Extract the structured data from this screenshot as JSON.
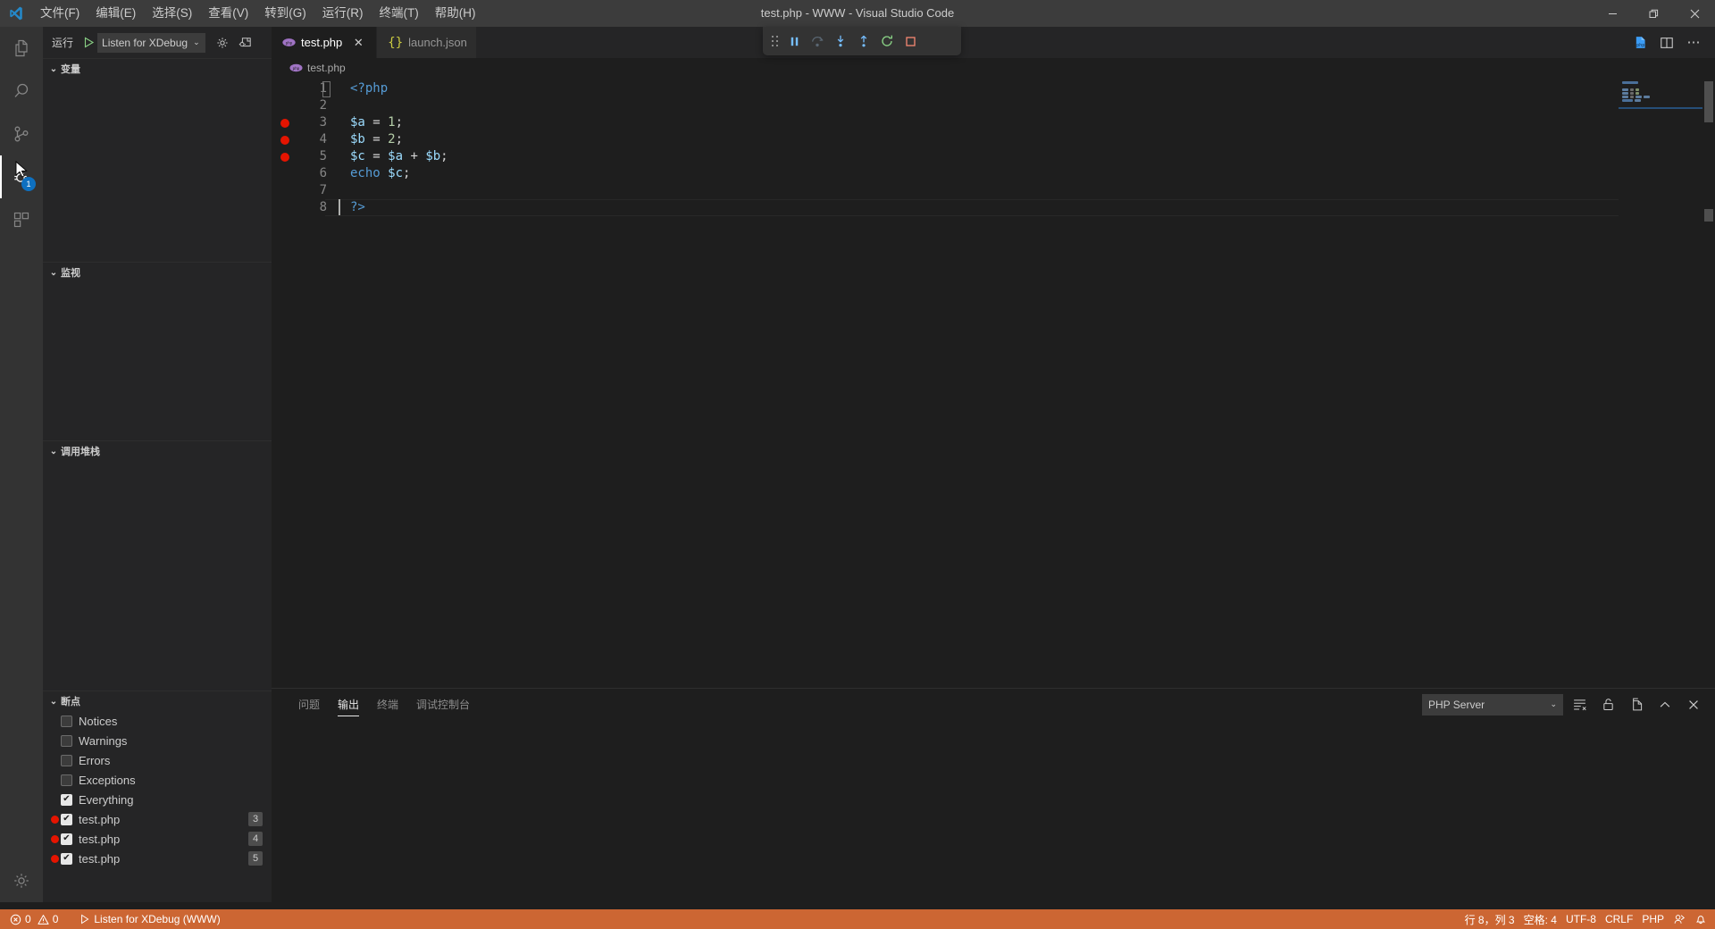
{
  "window": {
    "title": "test.php - WWW - Visual Studio Code",
    "controls": {
      "minimize": "minimize-icon",
      "maximize": "restore-icon",
      "close": "close-icon"
    }
  },
  "menubar": {
    "items": [
      {
        "label": "文件(F)",
        "name": "menu-file"
      },
      {
        "label": "编辑(E)",
        "name": "menu-edit"
      },
      {
        "label": "选择(S)",
        "name": "menu-selection"
      },
      {
        "label": "查看(V)",
        "name": "menu-view"
      },
      {
        "label": "转到(G)",
        "name": "menu-go"
      },
      {
        "label": "运行(R)",
        "name": "menu-run"
      },
      {
        "label": "终端(T)",
        "name": "menu-terminal"
      },
      {
        "label": "帮助(H)",
        "name": "menu-help"
      }
    ]
  },
  "activitybar": {
    "items": [
      {
        "icon": "explorer-icon",
        "name": "activity-explorer",
        "active": false,
        "badge": ""
      },
      {
        "icon": "search-icon",
        "name": "activity-search",
        "active": false,
        "badge": ""
      },
      {
        "icon": "source-control-icon",
        "name": "activity-source-control",
        "active": false,
        "badge": ""
      },
      {
        "icon": "run-and-debug-icon",
        "name": "activity-run-debug",
        "active": true,
        "badge": "1"
      },
      {
        "icon": "extensions-icon",
        "name": "activity-extensions",
        "active": false,
        "badge": ""
      }
    ],
    "manage": {
      "icon": "gear-icon",
      "name": "activity-manage"
    }
  },
  "debug_sidebar": {
    "run_label": "运行",
    "configuration": "Listen for XDebug",
    "config_caret": "⌄",
    "start_icon": "play-icon",
    "gear_icon": "gear-icon",
    "open_debug_icon": "open-debug-console-icon",
    "sections": [
      {
        "title": "变量",
        "name": "section-variables",
        "chevron": "⌄"
      },
      {
        "title": "监视",
        "name": "section-watch",
        "chevron": "⌄"
      },
      {
        "title": "调用堆栈",
        "name": "section-call-stack",
        "chevron": "⌄"
      },
      {
        "title": "断点",
        "name": "section-breakpoints",
        "chevron": "⌄"
      }
    ],
    "breakpoints": [
      {
        "label": "Notices",
        "checked": false,
        "dot": false,
        "line": ""
      },
      {
        "label": "Warnings",
        "checked": false,
        "dot": false,
        "line": ""
      },
      {
        "label": "Errors",
        "checked": false,
        "dot": false,
        "line": ""
      },
      {
        "label": "Exceptions",
        "checked": false,
        "dot": false,
        "line": ""
      },
      {
        "label": "Everything",
        "checked": true,
        "dot": false,
        "line": ""
      },
      {
        "label": "test.php",
        "checked": true,
        "dot": true,
        "line": "3"
      },
      {
        "label": "test.php",
        "checked": true,
        "dot": true,
        "line": "4"
      },
      {
        "label": "test.php",
        "checked": true,
        "dot": true,
        "line": "5"
      }
    ],
    "check_glyph": "✔"
  },
  "editor": {
    "tabs": [
      {
        "label": "test.php",
        "icon": "php-file-icon",
        "active": true,
        "close": "✕"
      },
      {
        "label": "launch.json",
        "icon": "json-file-icon",
        "active": false,
        "close": "✕"
      }
    ],
    "actions": [
      {
        "icon": "run-php-icon",
        "name": "run-php-button"
      },
      {
        "icon": "split-editor-icon",
        "name": "split-editor-button"
      },
      {
        "icon": "more-actions-icon",
        "name": "more-actions-button",
        "glyph": "⋯"
      }
    ],
    "breadcrumb": [
      {
        "label": "test.php",
        "icon": "php-file-icon"
      }
    ],
    "filename": "test.php",
    "lines": [
      {
        "num": "1",
        "breakpoint": false,
        "tokens": [
          {
            "t": "<?php",
            "c": "tag"
          }
        ]
      },
      {
        "num": "2",
        "breakpoint": false,
        "tokens": []
      },
      {
        "num": "3",
        "breakpoint": true,
        "tokens": [
          {
            "t": "$a",
            "c": "var"
          },
          {
            "t": " = ",
            "c": "op"
          },
          {
            "t": "1",
            "c": "num"
          },
          {
            "t": ";",
            "c": "punc"
          }
        ]
      },
      {
        "num": "4",
        "breakpoint": true,
        "tokens": [
          {
            "t": "$b",
            "c": "var"
          },
          {
            "t": " = ",
            "c": "op"
          },
          {
            "t": "2",
            "c": "num"
          },
          {
            "t": ";",
            "c": "punc"
          }
        ]
      },
      {
        "num": "5",
        "breakpoint": true,
        "tokens": [
          {
            "t": "$c",
            "c": "var"
          },
          {
            "t": " = ",
            "c": "op"
          },
          {
            "t": "$a",
            "c": "var"
          },
          {
            "t": " + ",
            "c": "op"
          },
          {
            "t": "$b",
            "c": "var"
          },
          {
            "t": ";",
            "c": "punc"
          }
        ]
      },
      {
        "num": "6",
        "breakpoint": false,
        "tokens": [
          {
            "t": "echo",
            "c": "kw"
          },
          {
            "t": " ",
            "c": "op"
          },
          {
            "t": "$c",
            "c": "var"
          },
          {
            "t": ";",
            "c": "punc"
          }
        ]
      },
      {
        "num": "7",
        "breakpoint": false,
        "tokens": []
      },
      {
        "num": "8",
        "breakpoint": false,
        "tokens": [
          {
            "t": "?>",
            "c": "tag"
          }
        ]
      }
    ]
  },
  "panel": {
    "tabs": [
      {
        "label": "问题",
        "name": "panel-tab-problems",
        "active": false
      },
      {
        "label": "输出",
        "name": "panel-tab-output",
        "active": true
      },
      {
        "label": "终端",
        "name": "panel-tab-terminal",
        "active": false
      },
      {
        "label": "调试控制台",
        "name": "panel-tab-debug-console",
        "active": false
      }
    ],
    "channel": "PHP Server",
    "channel_caret": "⌄",
    "actions": [
      {
        "icon": "clear-output-icon",
        "name": "clear-output-button"
      },
      {
        "icon": "unlock-icon",
        "name": "toggle-lock-button"
      },
      {
        "icon": "open-in-editor-icon",
        "name": "open-in-editor-button"
      },
      {
        "icon": "maximize-panel-icon",
        "name": "maximize-panel-button"
      },
      {
        "icon": "close-panel-icon",
        "name": "close-panel-button"
      }
    ],
    "output_text": ""
  },
  "debug_toolbar": {
    "grip": "drag-handle-icon",
    "buttons": [
      {
        "icon": "pause-icon",
        "name": "debug-pause-button",
        "state": "active"
      },
      {
        "icon": "step-over-icon",
        "name": "debug-step-over-button",
        "state": "disabled"
      },
      {
        "icon": "step-into-icon",
        "name": "debug-step-into-button",
        "state": "active"
      },
      {
        "icon": "step-out-icon",
        "name": "debug-step-out-button",
        "state": "active"
      },
      {
        "icon": "restart-icon",
        "name": "debug-restart-button",
        "state": "green"
      },
      {
        "icon": "stop-icon",
        "name": "debug-stop-button",
        "state": "red"
      }
    ]
  },
  "statusbar": {
    "background": "#cc6633",
    "errors": "0",
    "warnings": "0",
    "error_icon": "error-icon",
    "warning_icon": "warning-icon",
    "debug_session": "Listen for XDebug (WWW)",
    "debug_icon": "play-icon",
    "right": [
      {
        "label": "行 8，列 3",
        "name": "status-cursor-position"
      },
      {
        "label": "空格: 4",
        "name": "status-indentation"
      },
      {
        "label": "UTF-8",
        "name": "status-encoding"
      },
      {
        "label": "CRLF",
        "name": "status-eol"
      },
      {
        "label": "PHP",
        "name": "status-language-mode"
      }
    ],
    "feedback_icon": "feedback-icon",
    "bell_icon": "bell-icon"
  },
  "colors": {
    "titlebar_bg": "#3c3c3c",
    "activitybar_bg": "#333333",
    "sidebar_bg": "#252526",
    "editor_bg": "#1e1e1e",
    "statusbar_debug": "#cc6633",
    "breakpoint_red": "#e51400",
    "accent_blue": "#0e70c0",
    "debug_blue": "#75beff",
    "restart_green": "#89d185",
    "stop_red": "#f48771"
  }
}
